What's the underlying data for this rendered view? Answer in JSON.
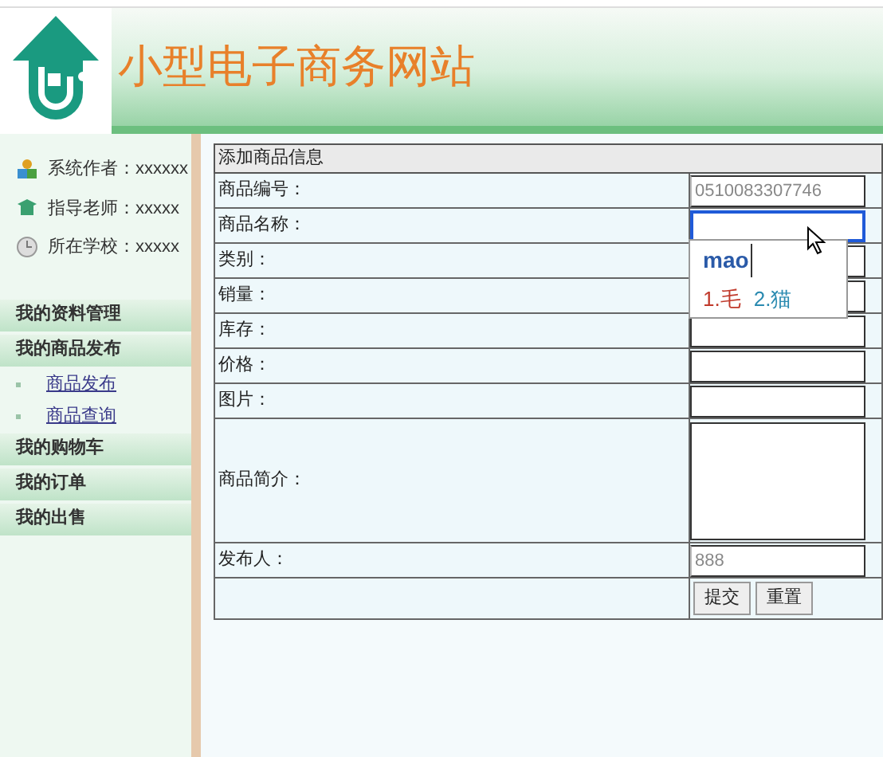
{
  "header": {
    "title": "小型电子商务网站"
  },
  "sidebar": {
    "info": [
      {
        "kind": "author",
        "text": "系统作者：xxxxxx"
      },
      {
        "kind": "teacher",
        "text": "指导老师：xxxxx"
      },
      {
        "kind": "school",
        "text": "所在学校：xxxxx"
      }
    ],
    "menu": [
      {
        "label": "我的资料管理"
      },
      {
        "label": "我的商品发布",
        "children": [
          {
            "label": "商品发布"
          },
          {
            "label": "商品查询"
          }
        ]
      },
      {
        "label": "我的购物车"
      },
      {
        "label": "我的订单"
      },
      {
        "label": "我的出售"
      }
    ]
  },
  "form": {
    "title": "添加商品信息",
    "rows": [
      {
        "kind": "text",
        "label": "商品编号：",
        "value": "0510083307746",
        "readonly": true,
        "focused": false
      },
      {
        "kind": "text",
        "label": "商品名称：",
        "value": "",
        "readonly": false,
        "focused": true
      },
      {
        "kind": "text",
        "label": "类别：",
        "value": ""
      },
      {
        "kind": "text",
        "label": "销量：",
        "value": ""
      },
      {
        "kind": "text",
        "label": "库存：",
        "value": "",
        "readonly": false,
        "focused": false
      },
      {
        "kind": "text",
        "label": "价格：",
        "value": "",
        "readonly": false,
        "focused": false
      },
      {
        "kind": "text",
        "label": "图片：",
        "value": "",
        "readonly": false,
        "focused": false
      },
      {
        "kind": "textarea",
        "label": "商品简介：",
        "value": ""
      },
      {
        "kind": "text",
        "label": "发布人：",
        "value": "888",
        "readonly": true,
        "focused": false
      },
      {
        "kind": "buttons",
        "buttons": [
          "提交",
          "重置"
        ]
      }
    ]
  },
  "ime": {
    "input": "mao",
    "candidates": [
      "1.毛",
      "2.猫"
    ]
  }
}
